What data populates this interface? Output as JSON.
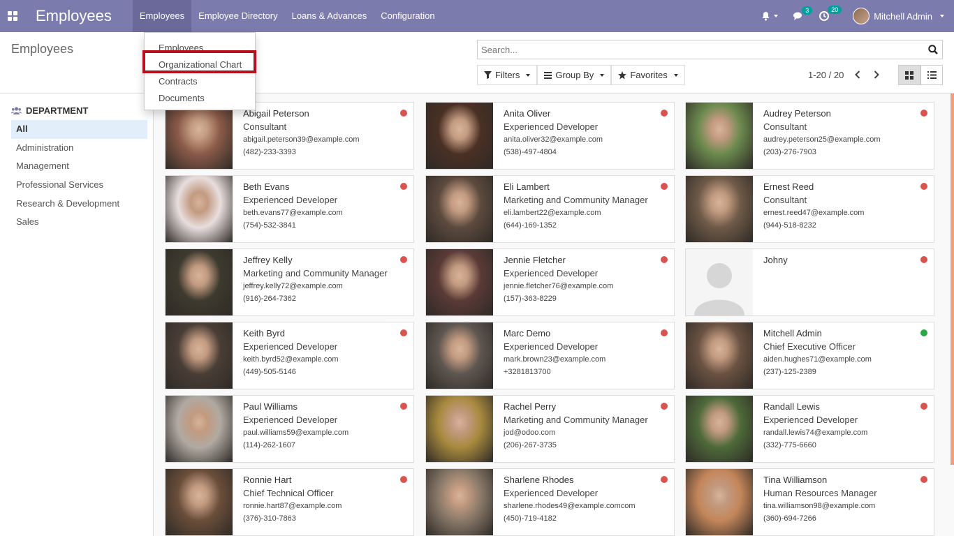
{
  "app": {
    "brand": "Employees"
  },
  "menu": [
    {
      "label": "Employees",
      "active": true
    },
    {
      "label": "Employee Directory",
      "active": false
    },
    {
      "label": "Loans & Advances",
      "active": false
    },
    {
      "label": "Configuration",
      "active": false
    }
  ],
  "nav_right": {
    "messages_badge": "3",
    "activities_badge": "20",
    "user_name": "Mitchell Admin"
  },
  "dropdown": {
    "items": [
      "Employees",
      "Organizational Chart",
      "Contracts",
      "Documents"
    ],
    "highlighted": "Organizational Chart"
  },
  "control_panel": {
    "breadcrumb": "Employees",
    "search_placeholder": "Search...",
    "filters": "Filters",
    "group_by": "Group By",
    "favorites": "Favorites",
    "pager": "1-20 / 20"
  },
  "sidebar": {
    "title": "DEPARTMENT",
    "items": [
      "All",
      "Administration",
      "Management",
      "Professional Services",
      "Research & Development",
      "Sales"
    ],
    "active": "All"
  },
  "employees": [
    {
      "name": "Abigail Peterson",
      "job": "Consultant",
      "email": "abigail.peterson39@example.com",
      "phone": "(482)-233-3393",
      "present": false,
      "photo": "#8a5a48"
    },
    {
      "name": "Anita Oliver",
      "job": "Experienced Developer",
      "email": "anita.oliver32@example.com",
      "phone": "(538)-497-4804",
      "present": false,
      "photo": "#4a3024"
    },
    {
      "name": "Audrey Peterson",
      "job": "Consultant",
      "email": "audrey.peterson25@example.com",
      "phone": "(203)-276-7903",
      "present": false,
      "photo": "#6b8a4e"
    },
    {
      "name": "Beth Evans",
      "job": "Experienced Developer",
      "email": "beth.evans77@example.com",
      "phone": "(754)-532-3841",
      "present": false,
      "photo": "#e8dede"
    },
    {
      "name": "Eli Lambert",
      "job": "Marketing and Community Manager",
      "email": "eli.lambert22@example.com",
      "phone": "(644)-169-1352",
      "present": false,
      "photo": "#5c4a3e"
    },
    {
      "name": "Ernest Reed",
      "job": "Consultant",
      "email": "ernest.reed47@example.com",
      "phone": "(944)-518-8232",
      "present": false,
      "photo": "#6e5a48"
    },
    {
      "name": "Jeffrey Kelly",
      "job": "Marketing and Community Manager",
      "email": "jeffrey.kelly72@example.com",
      "phone": "(916)-264-7362",
      "present": false,
      "photo": "#3d3a2e"
    },
    {
      "name": "Jennie Fletcher",
      "job": "Experienced Developer",
      "email": "jennie.fletcher76@example.com",
      "phone": "(157)-363-8229",
      "present": false,
      "photo": "#5a3a36"
    },
    {
      "name": "Johny",
      "job": "",
      "email": "",
      "phone": "",
      "present": false,
      "photo": "placeholder"
    },
    {
      "name": "Keith Byrd",
      "job": "Experienced Developer",
      "email": "keith.byrd52@example.com",
      "phone": "(449)-505-5146",
      "present": false,
      "photo": "#4a3e36"
    },
    {
      "name": "Marc Demo",
      "job": "Experienced Developer",
      "email": "mark.brown23@example.com",
      "phone": "+3281813700",
      "present": false,
      "photo": "#5e5650"
    },
    {
      "name": "Mitchell Admin",
      "job": "Chief Executive Officer",
      "email": "aiden.hughes71@example.com",
      "phone": "(237)-125-2389",
      "present": true,
      "photo": "#6a5242"
    },
    {
      "name": "Paul Williams",
      "job": "Experienced Developer",
      "email": "paul.williams59@example.com",
      "phone": "(114)-262-1607",
      "present": false,
      "photo": "#b0aaa2"
    },
    {
      "name": "Rachel Perry",
      "job": "Marketing and Community Manager",
      "email": "jod@odoo.com",
      "phone": "(206)-267-3735",
      "present": false,
      "photo": "#a88a3e"
    },
    {
      "name": "Randall Lewis",
      "job": "Experienced Developer",
      "email": "randall.lewis74@example.com",
      "phone": "(332)-775-6660",
      "present": false,
      "photo": "#4e6a3a"
    },
    {
      "name": "Ronnie Hart",
      "job": "Chief Technical Officer",
      "email": "ronnie.hart87@example.com",
      "phone": "(376)-310-7863",
      "present": false,
      "photo": "#6a4e3a"
    },
    {
      "name": "Sharlene Rhodes",
      "job": "Experienced Developer",
      "email": "sharlene.rhodes49@example.comcom",
      "phone": "(450)-719-4182",
      "present": false,
      "photo": "#8a7a6a"
    },
    {
      "name": "Tina Williamson",
      "job": "Human Resources Manager",
      "email": "tina.williamson98@example.com",
      "phone": "(360)-694-7266",
      "present": false,
      "photo": "#c4865a"
    }
  ],
  "colors": {
    "navbar": "#7c7bad",
    "status_absent": "#d9534f",
    "status_present": "#28a745",
    "highlight_box": "#b8101d"
  }
}
